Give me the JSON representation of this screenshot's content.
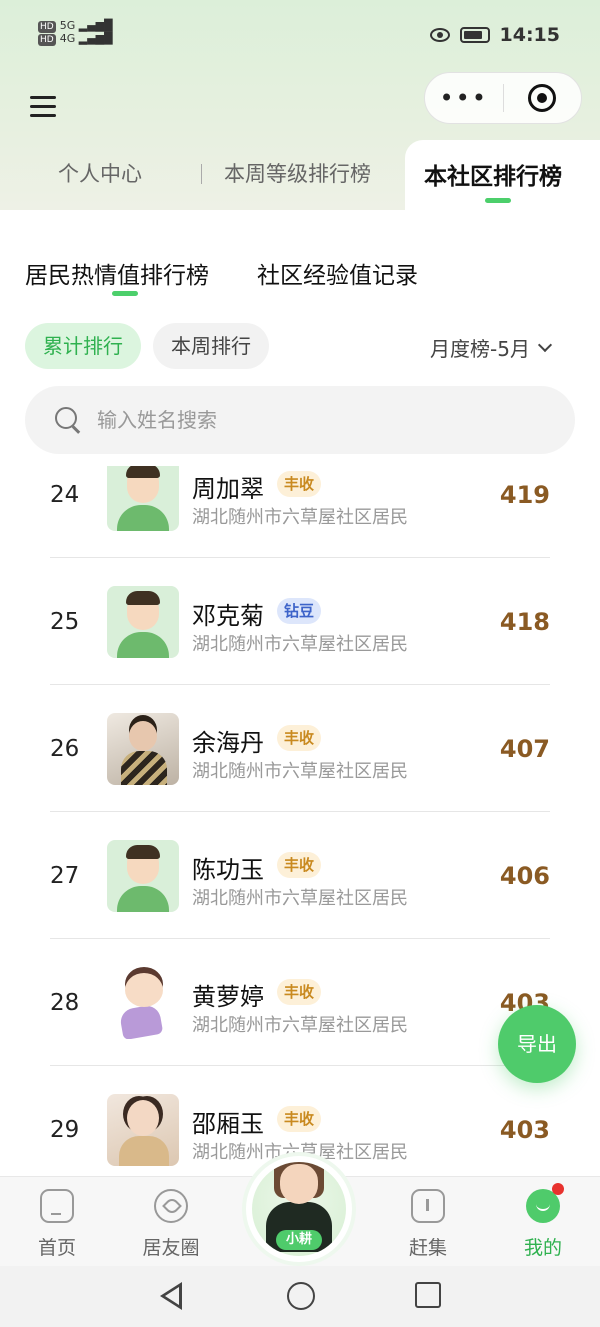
{
  "status_bar": {
    "time": "14:15",
    "signal_left": "5G",
    "signal_right": "4G",
    "hd1": "HD",
    "hd2": "HD"
  },
  "header": {
    "tabs": [
      {
        "label": "个人中心"
      },
      {
        "label": "本周等级排行榜"
      },
      {
        "label": "本社区排行榜"
      }
    ],
    "capsule_more": "•••"
  },
  "sub_tabs": [
    {
      "label": "居民热情值排行榜"
    },
    {
      "label": "社区经验值记录"
    }
  ],
  "filters": {
    "cumulative": "累计排行",
    "weekly": "本周排行",
    "month": "月度榜-5月"
  },
  "search": {
    "placeholder": "输入姓名搜索"
  },
  "rows": [
    {
      "rank": "24",
      "name": "周加翠",
      "badge": "丰收",
      "addr": "湖北随州市六草屋社区居民",
      "score": "419"
    },
    {
      "rank": "25",
      "name": "邓克菊",
      "badge": "钻豆",
      "addr": "湖北随州市六草屋社区居民",
      "score": "418"
    },
    {
      "rank": "26",
      "name": "余海丹",
      "badge": "丰收",
      "addr": "湖北随州市六草屋社区居民",
      "score": "407"
    },
    {
      "rank": "27",
      "name": "陈功玉",
      "badge": "丰收",
      "addr": "湖北随州市六草屋社区居民",
      "score": "406"
    },
    {
      "rank": "28",
      "name": "黄萝婷",
      "badge": "丰收",
      "addr": "湖北随州市六草屋社区居民",
      "score": "403"
    },
    {
      "rank": "29",
      "name": "邵厢玉",
      "badge": "丰收",
      "addr": "湖北随州市六草屋社区居民",
      "score": "403"
    }
  ],
  "export_label": "导出",
  "bottom_nav": [
    {
      "label": "首页"
    },
    {
      "label": "居友圈"
    },
    {
      "label": "小耕"
    },
    {
      "label": "赶集"
    },
    {
      "label": "我的"
    }
  ],
  "colors": {
    "accent": "#4fcb6b",
    "score": "#8a5a23",
    "badge_harvest": "#c98a20",
    "badge_diamond": "#3d63c9"
  }
}
